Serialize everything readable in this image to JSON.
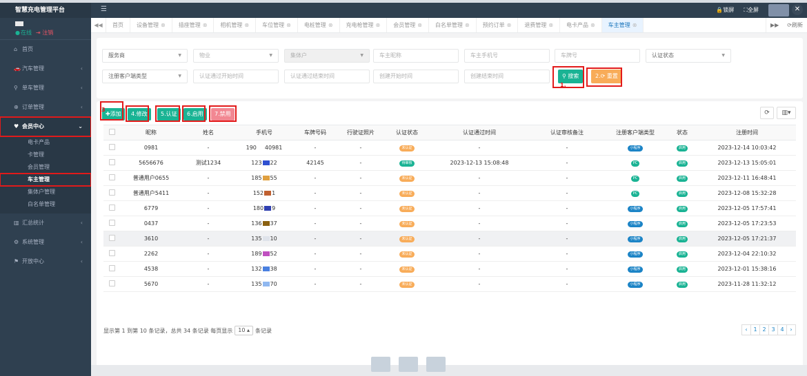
{
  "app": {
    "title": "智慧充电管理平台"
  },
  "user": {
    "online": "在线",
    "logout": "注销"
  },
  "sidebar": {
    "items": [
      {
        "icon": "home-icon",
        "glyph": "⌂",
        "label": "首页"
      },
      {
        "icon": "car-icon",
        "glyph": "🚗",
        "label": "汽车管理"
      },
      {
        "icon": "bike-icon",
        "glyph": "⚲",
        "label": "单车管理"
      },
      {
        "icon": "order-icon",
        "glyph": "⊕",
        "label": "订单管理"
      },
      {
        "icon": "member-icon",
        "glyph": "♥",
        "label": "会员中心"
      },
      {
        "icon": "chart-icon",
        "glyph": "▥",
        "label": "汇总统计"
      },
      {
        "icon": "gear-icon",
        "glyph": "⚙",
        "label": "系统管理"
      },
      {
        "icon": "dev-icon",
        "glyph": "⚑",
        "label": "开放中心"
      }
    ],
    "member_sub": [
      "电卡产品",
      "卡管理",
      "会员管理",
      "车主管理",
      "集体户管理",
      "白名单管理"
    ]
  },
  "topbar": {
    "lock": "锁屏",
    "fullscreen": "全屏"
  },
  "tabs": {
    "home": "首页",
    "items": [
      "设备管理",
      "插座管理",
      "相机管理",
      "车位管理",
      "电桩管理",
      "充电枪管理",
      "会员管理",
      "白名单管理",
      "预约订单",
      "退费管理",
      "电卡产品",
      "车主管理"
    ],
    "refresh": "刷新"
  },
  "search": {
    "service_provider": "服务商",
    "property": "物业",
    "collective": "集体户",
    "owner_nickname": "车主昵称",
    "owner_phone": "车主手机号",
    "plate_no": "车牌号",
    "auth_status": "认证状态",
    "client_type": "注册客户端类型",
    "auth_start": "认证通过开始时间",
    "auth_end": "认证通过结束时间",
    "create_start": "创建开始时间",
    "create_end": "创建结束时间",
    "search_btn": "搜索",
    "reset_btn": "重置",
    "step1": "1.",
    "step2": "2."
  },
  "toolbar": {
    "add": "添加",
    "edit": "修改",
    "auth": "认证",
    "enable": "启用",
    "disable": "禁用",
    "step3": "3",
    "step4": "4.",
    "step5": "5.",
    "step6": "6.",
    "step7": "7."
  },
  "table": {
    "headers": [
      "昵称",
      "姓名",
      "手机号",
      "车牌号码",
      "行驶证照片",
      "认证状态",
      "认证通过时间",
      "认证审核备注",
      "注册客户端类型",
      "状态",
      "注册时间"
    ],
    "rows": [
      {
        "nick": "0981",
        "name": "-",
        "phone_a": "190",
        "phone_b": "40981",
        "plate": "-",
        "photo": "-",
        "auth": "未认证",
        "auth_cls": "b-orange",
        "auth_time": "-",
        "remark": "-",
        "client": "小程序",
        "client_cls": "b-blue",
        "status": "启用",
        "reg": "2023-12-14 10:03:42",
        "pix": [
          "#ffffff"
        ]
      },
      {
        "nick": "5656676",
        "name": "测试1234",
        "phone_a": "123",
        "phone_b": "22",
        "plate": "42145",
        "photo": "-",
        "auth": "待审核",
        "auth_cls": "b-teal",
        "auth_time": "2023-12-13 15:08:48",
        "remark": "-",
        "client": "PC",
        "client_cls": "b-green",
        "status": "启用",
        "reg": "2023-12-13 15:05:01",
        "pix": [
          "#3050d0"
        ]
      },
      {
        "nick": "普通用户0655",
        "name": "-",
        "phone_a": "185",
        "phone_b": "55",
        "plate": "-",
        "photo": "-",
        "auth": "未认证",
        "auth_cls": "b-orange",
        "auth_time": "-",
        "remark": "-",
        "client": "PC",
        "client_cls": "b-green",
        "status": "启用",
        "reg": "2023-12-11 16:48:41",
        "pix": [
          "#e0a040"
        ]
      },
      {
        "nick": "普通用户5411",
        "name": "-",
        "phone_a": "152",
        "phone_b": "1",
        "plate": "-",
        "photo": "-",
        "auth": "未认证",
        "auth_cls": "b-orange",
        "auth_time": "-",
        "remark": "-",
        "client": "PC",
        "client_cls": "b-green",
        "status": "启用",
        "reg": "2023-12-08 15:32:28",
        "pix": [
          "#c06030"
        ]
      },
      {
        "nick": "6779",
        "name": "-",
        "phone_a": "180",
        "phone_b": "9",
        "plate": "-",
        "photo": "-",
        "auth": "未认证",
        "auth_cls": "b-orange",
        "auth_time": "-",
        "remark": "-",
        "client": "小程序",
        "client_cls": "b-blue",
        "status": "启用",
        "reg": "2023-12-05 17:57:41",
        "pix": [
          "#3040b0"
        ]
      },
      {
        "nick": "0437",
        "name": "-",
        "phone_a": "136",
        "phone_b": "37",
        "plate": "-",
        "photo": "-",
        "auth": "未认证",
        "auth_cls": "b-orange",
        "auth_time": "-",
        "remark": "-",
        "client": "小程序",
        "client_cls": "b-blue",
        "status": "启用",
        "reg": "2023-12-05 17:23:53",
        "pix": [
          "#8a6010"
        ]
      },
      {
        "nick": "3610",
        "name": "-",
        "phone_a": "135",
        "phone_b": "10",
        "plate": "-",
        "photo": "-",
        "auth": "未认证",
        "auth_cls": "b-orange",
        "auth_time": "-",
        "remark": "-",
        "client": "小程序",
        "client_cls": "b-blue",
        "status": "启用",
        "reg": "2023-12-05 17:21:37",
        "pix": [
          "#dfe3ea"
        ]
      },
      {
        "nick": "2262",
        "name": "-",
        "phone_a": "189",
        "phone_b": "52",
        "plate": "-",
        "photo": "-",
        "auth": "未认证",
        "auth_cls": "b-orange",
        "auth_time": "-",
        "remark": "-",
        "client": "小程序",
        "client_cls": "b-blue",
        "status": "启用",
        "reg": "2023-12-04 22:10:32",
        "pix": [
          "#c050c0"
        ]
      },
      {
        "nick": "4538",
        "name": "-",
        "phone_a": "132",
        "phone_b": "38",
        "plate": "-",
        "photo": "-",
        "auth": "未认证",
        "auth_cls": "b-orange",
        "auth_time": "-",
        "remark": "-",
        "client": "小程序",
        "client_cls": "b-blue",
        "status": "启用",
        "reg": "2023-12-01 15:38:16",
        "pix": [
          "#4a80e0"
        ]
      },
      {
        "nick": "5670",
        "name": "-",
        "phone_a": "135",
        "phone_b": "70",
        "plate": "-",
        "photo": "-",
        "auth": "未认证",
        "auth_cls": "b-orange",
        "auth_time": "-",
        "remark": "-",
        "client": "小程序",
        "client_cls": "b-blue",
        "status": "启用",
        "reg": "2023-11-28 11:32:12",
        "pix": [
          "#90b8f0"
        ]
      }
    ]
  },
  "footer": {
    "info_pre": "显示第 1 到第 10 条记录，总共 34 条记录 每页显示",
    "page_size": "10",
    "info_post": "条记录",
    "pages": [
      "‹",
      "1",
      "2",
      "3",
      "4",
      "›"
    ]
  },
  "colors": {
    "sidebar": "#2f4050",
    "primary": "#1ab394",
    "warning": "#f8ac59",
    "danger": "#ed5565",
    "info": "#1c84c6",
    "annotation": "#e21a1a"
  }
}
